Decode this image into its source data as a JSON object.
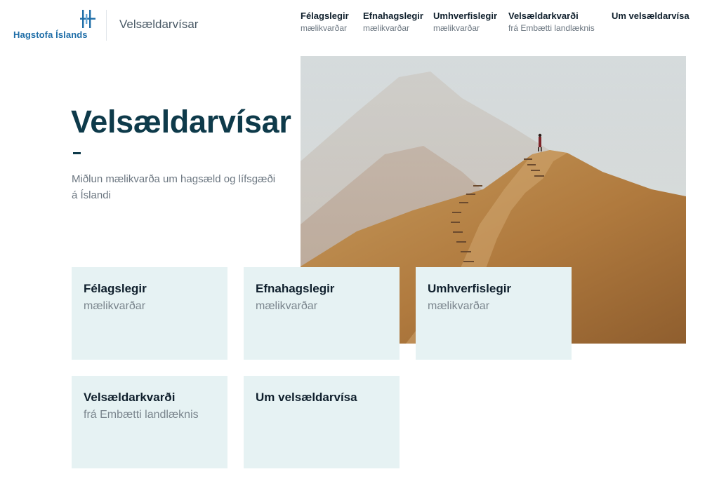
{
  "header": {
    "logo_text": "Hagstofa Íslands",
    "site_name": "Velsældarvísar",
    "brand_color": "#1f6ea8"
  },
  "nav": {
    "items": [
      {
        "title": "Félagslegir",
        "subtitle": "mælikvarðar"
      },
      {
        "title": "Efnahagslegir",
        "subtitle": "mælikvarðar"
      },
      {
        "title": "Umhverfislegir",
        "subtitle": "mælikvarðar"
      },
      {
        "title": "Velsældarkvarði",
        "subtitle": "frá Embætti landlæknis"
      },
      {
        "title": "Um velsældarvísa",
        "subtitle": ""
      }
    ]
  },
  "hero": {
    "title": "Velsældarvísar",
    "lead": "Miðlun mælikvarða um hagsæld og lífsgæði á Íslandi",
    "title_color": "#0e3a4a"
  },
  "tiles": [
    {
      "title": "Félagslegir",
      "subtitle": "mælikvarðar"
    },
    {
      "title": "Efnahagslegir",
      "subtitle": "mælikvarðar"
    },
    {
      "title": "Umhverfislegir",
      "subtitle": "mælikvarðar"
    },
    {
      "title": "Velsældarkvarði",
      "subtitle": "frá Embætti landlæknis"
    },
    {
      "title": "Um velsældarvísa",
      "subtitle": ""
    }
  ],
  "colors": {
    "tile_background": "#e6f2f3",
    "text_dark": "#0f1f2c",
    "text_muted": "#6b7680"
  }
}
